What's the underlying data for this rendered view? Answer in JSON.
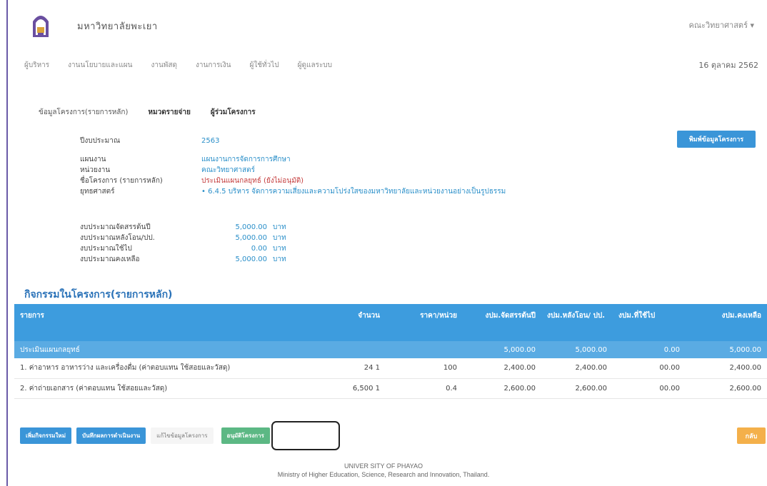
{
  "header": {
    "university_name": "มหาวิทยาลัยพะเยา",
    "user_menu": "คณะวิทยาศาสตร์ ▾"
  },
  "nav": {
    "items": [
      "ผู้บริหาร",
      "งานนโยบายและแผน",
      "งานพัสดุ",
      "งานการเงิน",
      "ผู้ใช้ทั่วไป",
      "ผู้ดูแลระบบ"
    ],
    "date": "16 ตุลาคม 2562"
  },
  "subtabs": [
    "ข้อมูลโครงการ(รายการหลัก)",
    "หมวดรายจ่าย",
    "ผู้ร่วมโครงการ"
  ],
  "info": {
    "fiscal_year_label": "ปีงบประมาณ",
    "fiscal_year": "2563",
    "plan_label": "แผนงาน",
    "plan": "แผนงานการจัดการการศึกษา",
    "unit_label": "หน่วยงาน",
    "unit": "คณะวิทยาศาสตร์",
    "project_label": "ชื่อโครงการ (รายการหลัก)",
    "project": "ประเมินแผนกลยุทธ์ (ยังไม่อนุมัติ)",
    "strategy_label": "ยุทธศาสตร์",
    "strategy": "• 6.4.5 บริหาร จัดการความเสี่ยงและความโปร่งใสของมหาวิทยาลัยและหน่วยงานอย่างเป็นรูปธรรม"
  },
  "budget": [
    {
      "label": "งบประมาณจัดสรรต้นปี",
      "value": "5,000.00",
      "unit": "บาท"
    },
    {
      "label": "งบประมาณหลังโอน/ปป.",
      "value": "5,000.00",
      "unit": "บาท"
    },
    {
      "label": "งบประมาณใช้ไป",
      "value": "0.00",
      "unit": "บาท"
    },
    {
      "label": "งบประมาณคงเหลือ",
      "value": "5,000.00",
      "unit": "บาท"
    }
  ],
  "print_button": "พิมพ์ข้อมูลโครงการ",
  "section_title": "กิจกรรมในโครงการ(รายการหลัก)",
  "table": {
    "headers": [
      "รายการ",
      "จำนวน",
      "ราคา/หน่วย",
      "งปม.จัดสรรต้นปี",
      "งปม.หลังโอน/ ปป.",
      "งปม.ที่ใช้ไป",
      "งปม.คงเหลือ"
    ],
    "group": {
      "name": "ประเมินแผนกลยุทธ์",
      "allocated": "5,000.00",
      "after_transfer": "5,000.00",
      "used": "0.00",
      "remaining": "5,000.00"
    },
    "rows": [
      {
        "name": "1. ค่าอาหาร อาหารว่าง และเครื่องดื่ม (ค่าตอบแทน ใช้สอยและวัสดุ)",
        "qty": "24 1",
        "price": "100",
        "allocated": "2,400.00",
        "after_transfer": "2,400.00",
        "used": "00.00",
        "remaining": "2,400.00"
      },
      {
        "name": "2. ค่าถ่ายเอกสาร (ค่าตอบแทน ใช้สอยและวัสดุ)",
        "qty": "6,500 1",
        "price": "0.4",
        "allocated": "2,600.00",
        "after_transfer": "2,600.00",
        "used": "00.00",
        "remaining": "2,600.00"
      }
    ]
  },
  "buttons": {
    "add_activity": "เพิ่มกิจกรรมใหม่",
    "record_result": "บันทึกผลการดำเนินงาน",
    "edit_project": "แก้ไขข้อมูลโครงการ",
    "approve_project": "อนุมัติโครงการ",
    "back": "กลับ"
  },
  "footer": {
    "line1": "UNIVER SITY OF PHAYAO",
    "line2": "Ministry of Higher Education, Science, Research and Innovation, Thailand."
  },
  "colors": {
    "accent": "#3d9cde",
    "group_row": "#5aabe3",
    "approve": "#5cb884",
    "back": "#f4b04a",
    "link": "#2a8fc9",
    "warning_text": "#c43b3b"
  }
}
